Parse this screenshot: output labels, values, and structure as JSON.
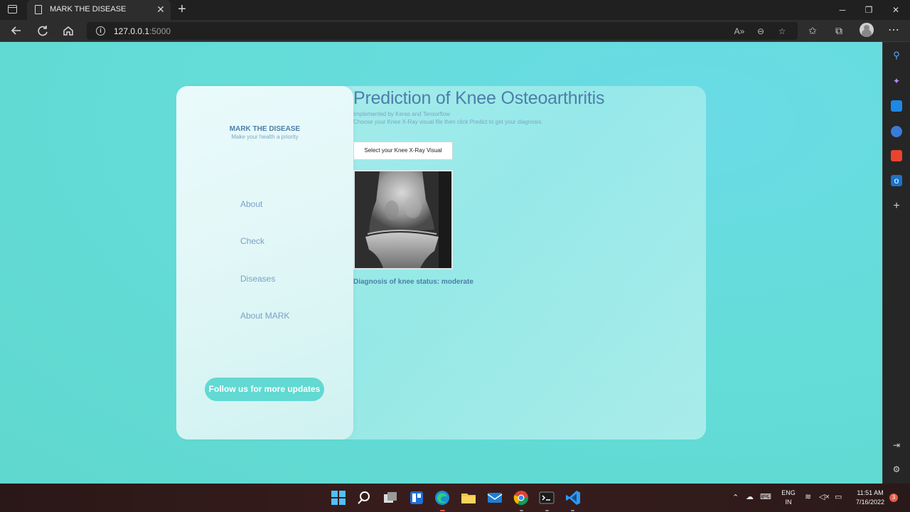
{
  "browser": {
    "tab_title": "MARK THE DISEASE",
    "url_host": "127.0.0.1",
    "url_port": ":5000"
  },
  "sidebar": {
    "brand_name": "MARK THE DISEASE",
    "brand_tagline": "Make your health a priority",
    "nav": [
      "About",
      "Check",
      "Diseases",
      "About MARK"
    ],
    "follow_button": "Follow us for more updates"
  },
  "main": {
    "title": "Prediction of Knee Osteoarthritis",
    "subtitle_1": "Implemented by Keras and Tensorflow",
    "subtitle_2": "Choose your Knee X-Ray visual file then click Predict to get your diagnosis.",
    "file_button": "Select your Knee X-Ray Visual",
    "diagnosis": "Diagnosis of knee status: moderate"
  },
  "taskbar": {
    "lang_1": "ENG",
    "lang_2": "IN",
    "time": "11:51 AM",
    "date": "7/16/2022",
    "notification_count": "3"
  },
  "colors": {
    "page_bg": "#62d9d2",
    "title": "#4d7ea8",
    "button_accent": "#62d9d2"
  }
}
